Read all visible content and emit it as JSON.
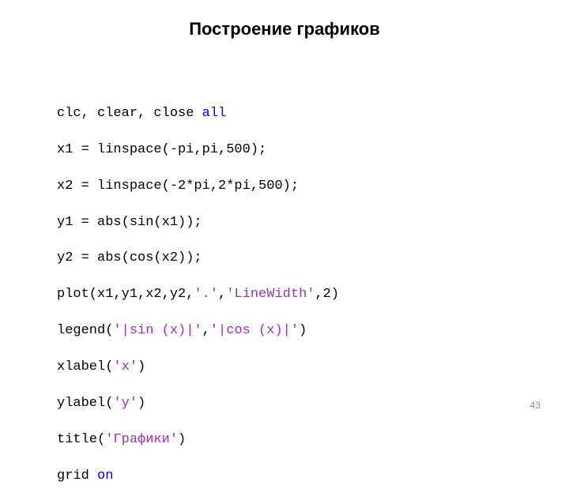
{
  "title": "Построение графиков",
  "page_number": "43",
  "code": {
    "line1_pre": "clc, clear, close ",
    "line1_kw": "all",
    "line2": "x1 = linspace(-pi,pi,500);",
    "line3": "x2 = linspace(-2*pi,2*pi,500);",
    "line4": "y1 = abs(sin(x1));",
    "line5": "y2 = abs(cos(x2));",
    "line6_pre": "plot(x1,y1,x2,y2,",
    "line6_s1": "'.'",
    "line6_mid": ",",
    "line6_s2": "'LineWidth'",
    "line6_post": ",2)",
    "line7_pre": "legend(",
    "line7_s1": "'|sin (x)|'",
    "line7_mid": ",",
    "line7_s2": "'|cos (x)|'",
    "line7_post": ")",
    "line8_pre": "xlabel(",
    "line8_s": "'x'",
    "line8_post": ")",
    "line9_pre": "ylabel(",
    "line9_s": "'y'",
    "line9_post": ")",
    "line10_pre": "title(",
    "line10_s": "'Графики'",
    "line10_post": ")",
    "line11_pre": "grid ",
    "line11_kw": "on"
  }
}
